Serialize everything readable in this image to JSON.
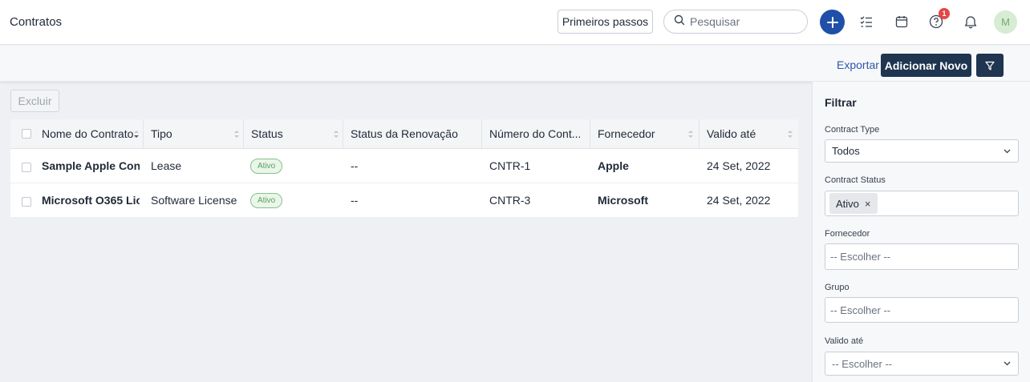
{
  "header": {
    "title": "Contratos",
    "first_steps_label": "Primeiros passos",
    "search_placeholder": "Pesquisar",
    "help_badge": "1",
    "avatar_initial": "M"
  },
  "toolbar": {
    "export_label": "Exportar",
    "add_label": "Adicionar Novo"
  },
  "actions": {
    "delete_label": "Excluir"
  },
  "table": {
    "columns": [
      "Nome do Contrato",
      "Tipo",
      "Status",
      "Status da Renovação",
      "Número do Cont...",
      "Fornecedor",
      "Valido até"
    ],
    "rows": [
      {
        "name": "Sample Apple Con...",
        "type": "Lease",
        "status": "Ativo",
        "renewal": "--",
        "number": "CNTR-1",
        "vendor": "Apple",
        "valid_until": "24 Set, 2022"
      },
      {
        "name": "Microsoft O365 Lic...",
        "type": "Software License",
        "status": "Ativo",
        "renewal": "--",
        "number": "CNTR-3",
        "vendor": "Microsoft",
        "valid_until": "24 Set, 2022"
      }
    ]
  },
  "filter": {
    "title": "Filtrar",
    "contract_type_label": "Contract Type",
    "contract_type_value": "Todos",
    "contract_status_label": "Contract Status",
    "contract_status_chip": "Ativo",
    "vendor_label": "Fornecedor",
    "vendor_placeholder": "-- Escolher --",
    "group_label": "Grupo",
    "group_placeholder": "-- Escolher --",
    "valid_until_label": "Valido até",
    "valid_until_placeholder": "-- Escolher --"
  },
  "colors": {
    "primary_dark": "#1f3550",
    "plus_blue": "#1f4fa8",
    "link_blue": "#2b57a8",
    "status_green": "#5a9e5e",
    "badge_red": "#e64545"
  }
}
